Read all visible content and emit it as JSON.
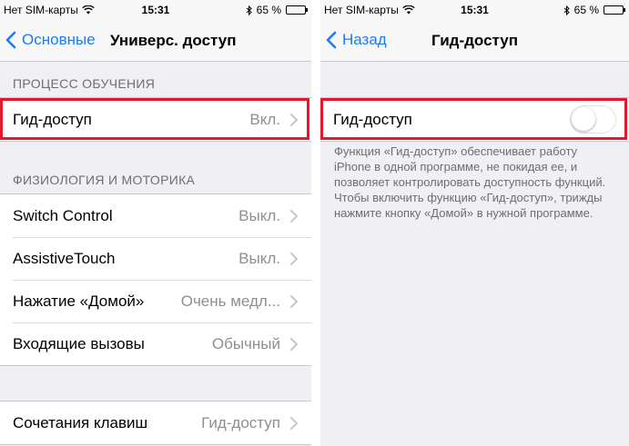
{
  "left": {
    "status": {
      "carrier": "Нет SIM-карты",
      "time": "15:31",
      "battery": "65 %",
      "battery_level": 0.65
    },
    "nav": {
      "back_label": "Основные",
      "title": "Универс. доступ"
    },
    "section1": {
      "header": "ПРОЦЕСС ОБУЧЕНИЯ",
      "rows": [
        {
          "label": "Гид-доступ",
          "value": "Вкл."
        }
      ]
    },
    "section2": {
      "header": "ФИЗИОЛОГИЯ И МОТОРИКА",
      "rows": [
        {
          "label": "Switch Control",
          "value": "Выкл."
        },
        {
          "label": "AssistiveTouch",
          "value": "Выкл."
        },
        {
          "label": "Нажатие «Домой»",
          "value": "Очень медл..."
        },
        {
          "label": "Входящие вызовы",
          "value": "Обычный"
        }
      ]
    },
    "section3": {
      "rows": [
        {
          "label": "Сочетания клавиш",
          "value": "Гид-доступ"
        }
      ]
    }
  },
  "right": {
    "status": {
      "carrier": "Нет SIM-карты",
      "time": "15:31",
      "battery": "65 %",
      "battery_level": 0.65
    },
    "nav": {
      "back_label": "Назад",
      "title": "Гид-доступ"
    },
    "row": {
      "label": "Гид-доступ",
      "toggle_on": false
    },
    "footer": "Функция «Гид-доступ» обеспечивает работу iPhone в одной программе, не покидая ее, и позволяет контролировать доступность функций. Чтобы включить функцию «Гид-доступ», трижды нажмите кнопку «Домой» в нужной программе."
  },
  "colors": {
    "accent": "#1a7cf5",
    "highlight": "#e3182d",
    "background": "#efeff4"
  }
}
